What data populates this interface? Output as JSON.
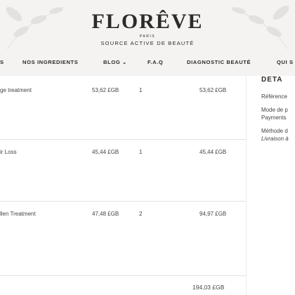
{
  "header": {
    "brand": "FLORÊVE",
    "brand_city": "PARIS",
    "tagline": "SOURCE ACTIVE DE BEAUTÉ",
    "nav": [
      {
        "label": "S"
      },
      {
        "label": "NOS INGREDIENTS"
      },
      {
        "label": "BLOG ⌄"
      },
      {
        "label": "F.A.Q"
      },
      {
        "label": "DIAGNOSTIC BEAUTÉ"
      },
      {
        "label": "QUI S"
      }
    ]
  },
  "order": {
    "items": [
      {
        "name": "ge treatment",
        "price": "53,62 £GB",
        "qty": "1",
        "total": "53,62 £GB"
      },
      {
        "name": "ir Loss",
        "price": "45,44 £GB",
        "qty": "1",
        "total": "45,44 £GB"
      },
      {
        "name": "llen Treatment",
        "price": "47,48 £GB",
        "qty": "2",
        "total": "94,97 £GB"
      }
    ],
    "grand_total": "194,03 £GB"
  },
  "sidebar": {
    "heading": "DETA",
    "reference": "Référence",
    "payment_label": "Mode de p",
    "payment_value": "Payments",
    "shipping_label": "Méthode d",
    "shipping_value": "Livraison à"
  }
}
